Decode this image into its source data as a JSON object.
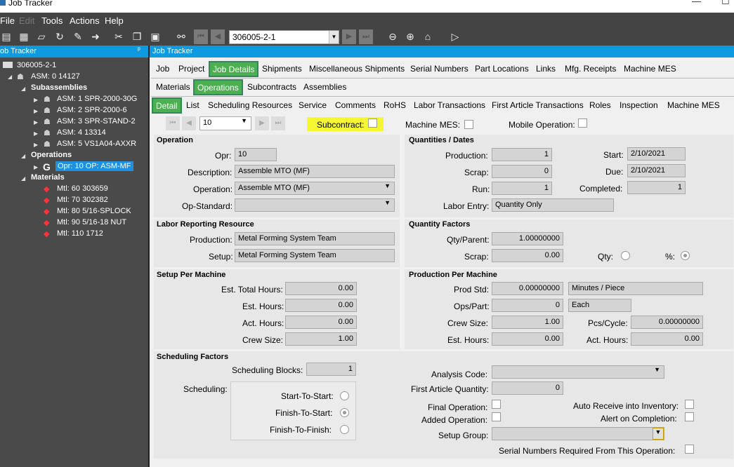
{
  "window": {
    "title": "Job Tracker",
    "min": "—",
    "max": "☐"
  },
  "menu": [
    "File",
    "Edit",
    "Tools",
    "Actions",
    "Help"
  ],
  "toolbar": {
    "job_value": "306005-2-1"
  },
  "left": {
    "header": "ob Tracker",
    "pin": "ᵖ",
    "root": "306005-2-1",
    "asm": "ASM: 0 14127",
    "subassemblies_label": "Subassemblies",
    "subassemblies": [
      "ASM: 1 SPR-2000-30G",
      "ASM: 2 SPR-2000-6",
      "ASM: 3 SPR-STAND-2",
      "ASM: 4 13314",
      "ASM: 5 VS1A04-AXXR"
    ],
    "operations_label": "Operations",
    "operation": "Opr: 10 OP: ASM-MF",
    "materials_label": "Materials",
    "materials": [
      "Mtl: 60 303659",
      "Mtl: 70 302382",
      "Mtl: 80 5/16-SPLOCK",
      "Mtl: 90 5/16-18 NUT",
      "Mtl: 110 1712"
    ]
  },
  "right": {
    "header": "Job Tracker",
    "tabs1": [
      "Job",
      "Project",
      "Job Details",
      "Shipments",
      "Miscellaneous Shipments",
      "Serial Numbers",
      "Part Locations",
      "Links",
      "Mfg. Receipts",
      "Machine MES"
    ],
    "tabs2": [
      "Materials",
      "Operations",
      "Subcontracts",
      "Assemblies"
    ],
    "tabs3": [
      "Detail",
      "List",
      "Scheduling Resources",
      "Service",
      "Comments",
      "RoHS",
      "Labor Transactions",
      "First Article Transactions",
      "Roles",
      "Inspection",
      "Machine MES"
    ],
    "nav_value": "10",
    "subcontract_label": "Subcontract:",
    "machine_mes_label": "Machine MES:",
    "mobile_op_label": "Mobile Operation:",
    "operation": {
      "title": "Operation",
      "opr_label": "Opr:",
      "opr": "10",
      "desc_label": "Description:",
      "desc": "Assemble MTO (MF)",
      "op_label": "Operation:",
      "op": "Assemble MTO (MF)",
      "std_label": "Op-Standard:",
      "std": ""
    },
    "qty": {
      "title": "Quantities / Dates",
      "prod_label": "Production:",
      "prod": "1",
      "scrap_label": "Scrap:",
      "scrap": "0",
      "run_label": "Run:",
      "run": "1",
      "labor_label": "Labor Entry:",
      "labor": "Quantity Only",
      "start_label": "Start:",
      "start": "2/10/2021",
      "due_label": "Due:",
      "due": "2/10/2021",
      "comp_label": "Completed:",
      "comp": "1"
    },
    "labor": {
      "title": "Labor Reporting Resource",
      "prod_label": "Production:",
      "prod": "Metal Forming System Team",
      "setup_label": "Setup:",
      "setup": "Metal Forming System Team"
    },
    "qf": {
      "title": "Quantity Factors",
      "qp_label": "Qty/Parent:",
      "qp": "1.00000000",
      "scrap_label": "Scrap:",
      "scrap": "0.00",
      "qty_label": "Qty:",
      "pct_label": "%:"
    },
    "setup": {
      "title": "Setup Per Machine",
      "eth_label": "Est. Total Hours:",
      "eth": "0.00",
      "eh_label": "Est. Hours:",
      "eh": "0.00",
      "ah_label": "Act. Hours:",
      "ah": "0.00",
      "cs_label": "Crew Size:",
      "cs": "1.00"
    },
    "ppm": {
      "title": "Production Per Machine",
      "ps_label": "Prod Std:",
      "ps": "0.00000000",
      "ps_unit": "Minutes / Piece",
      "op_label": "Ops/Part:",
      "op": "0",
      "op_unit": "Each",
      "cs_label": "Crew Size:",
      "cs": "1.00",
      "pc_label": "Pcs/Cycle:",
      "pc": "0.00000000",
      "eh_label": "Est. Hours:",
      "eh": "0.00",
      "ah_label": "Act. Hours:",
      "ah": "0.00"
    },
    "sf": {
      "title": "Scheduling Factors",
      "sb_label": "Scheduling Blocks:",
      "sb": "1",
      "sched_label": "Scheduling:",
      "sts": "Start-To-Start:",
      "fts": "Finish-To-Start:",
      "ftf": "Finish-To-Finish:",
      "ac_label": "Analysis Code:",
      "faq_label": "First Article Quantity:",
      "faq": "0",
      "final_label": "Final Operation:",
      "added_label": "Added Operation:",
      "sg_label": "Setup Group:",
      "auto_label": "Auto Receive into Inventory:",
      "alert_label": "Alert on Completion:",
      "serial_label": "Serial Numbers Required From This Operation:"
    }
  }
}
